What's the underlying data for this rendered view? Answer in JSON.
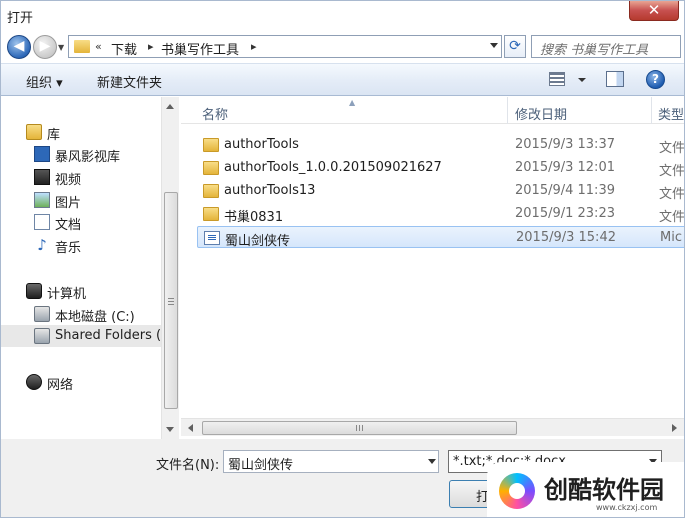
{
  "window": {
    "title": "打开",
    "close_label": "✕"
  },
  "navbar": {
    "back_glyph": "◀",
    "forward_glyph": "▶",
    "history_glyph": "▼",
    "overflow_glyph": "«",
    "crumb_separator": "▸",
    "breadcrumbs": [
      "下载",
      "书巢写作工具"
    ],
    "refresh_glyph": "⟳",
    "search_placeholder": "搜索 书巢写作工具"
  },
  "toolbar": {
    "organize": "组织 ▾",
    "new_folder": "新建文件夹",
    "help": "?"
  },
  "nav_pane": {
    "libraries": "库",
    "items_lib": [
      "暴风影视库",
      "视频",
      "图片",
      "文档",
      "音乐"
    ],
    "computer": "计算机",
    "items_pc": [
      "本地磁盘 (C:)",
      "Shared Folders (\\"
    ],
    "network": "网络"
  },
  "file_list": {
    "columns": {
      "name": "名称",
      "modified": "修改日期",
      "type": "类型"
    },
    "rows": [
      {
        "name": "authorTools",
        "modified": "2015/9/3 13:37",
        "type": "文件",
        "icon": "folder-icon"
      },
      {
        "name": "authorTools_1.0.0.201509021627",
        "modified": "2015/9/3 12:01",
        "type": "文件",
        "icon": "folder-icon"
      },
      {
        "name": "authorTools13",
        "modified": "2015/9/4 11:39",
        "type": "文件",
        "icon": "folder-icon"
      },
      {
        "name": "书巢0831",
        "modified": "2015/9/1 23:23",
        "type": "文件",
        "icon": "folder-icon"
      },
      {
        "name": "蜀山剑侠传",
        "modified": "2015/9/3 15:42",
        "type": "Mic",
        "icon": "word-document-icon"
      }
    ],
    "selected_index": 4
  },
  "bottom": {
    "filename_label": "文件名(N):",
    "filename_value": "蜀山剑侠传",
    "filter_value": "*.txt;*.doc;*.docx",
    "open_label": "打开(O)"
  },
  "watermark": {
    "title": "创酷软件园",
    "url": "www.ckzxj.com"
  },
  "colors": {
    "accent": "#2d68b8",
    "selection_border": "#99c2f2",
    "selection_fill": "#d5e6fb",
    "close_red": "#c75050",
    "folder_yellow": "#e4b43a"
  }
}
